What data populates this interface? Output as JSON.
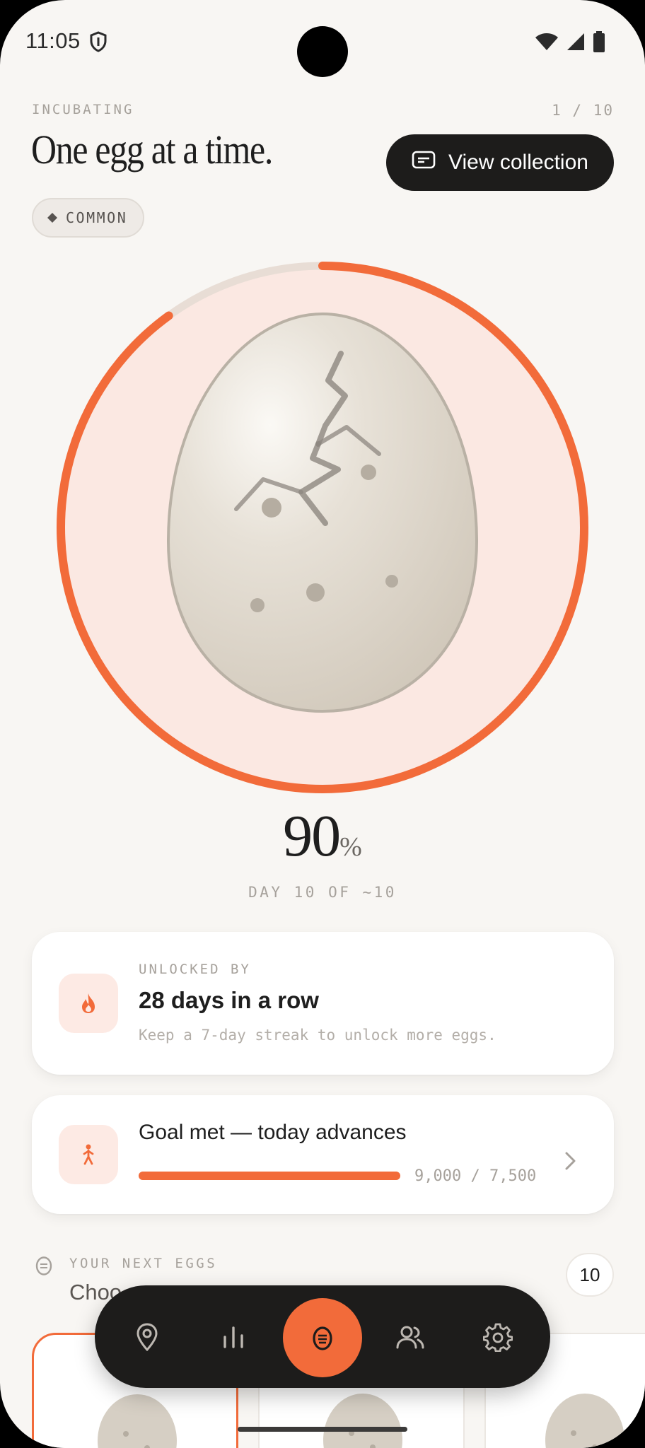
{
  "status_bar": {
    "time": "11:05",
    "icons": [
      "shield-icon",
      "wifi-icon",
      "cellular-signal-icon",
      "battery-icon"
    ]
  },
  "header": {
    "eyebrow": "INCUBATING",
    "counter": "1 / 10",
    "title": "One egg at a time.",
    "view_collection_label": "View collection",
    "rarity_label": "COMMON"
  },
  "incubation": {
    "progress_percent": 90,
    "percent_number": "90",
    "percent_sign": "%",
    "day_line": "DAY 10 OF ~10",
    "accent_color": "#f26b3a",
    "ring_track_color": "#e8ddd5",
    "ring_fill_color": "#fbe8e2"
  },
  "unlock_card": {
    "label": "UNLOCKED BY",
    "title": "28 days in a row",
    "subtitle": "Keep a 7-day streak to unlock more eggs.",
    "icon": "flame-icon"
  },
  "goal_card": {
    "title": "Goal met — today advances",
    "count": "9,000 / 7,500",
    "progress_fraction": 1.0,
    "icon": "walking-person-icon"
  },
  "next_eggs": {
    "label": "YOUR NEXT EGGS",
    "subtitle": "Choo",
    "count": "10"
  },
  "bottom_nav": {
    "items": [
      "map-pin-icon",
      "bar-chart-icon",
      "egg-icon",
      "people-icon",
      "settings-gear-icon"
    ],
    "active": "egg-icon"
  }
}
